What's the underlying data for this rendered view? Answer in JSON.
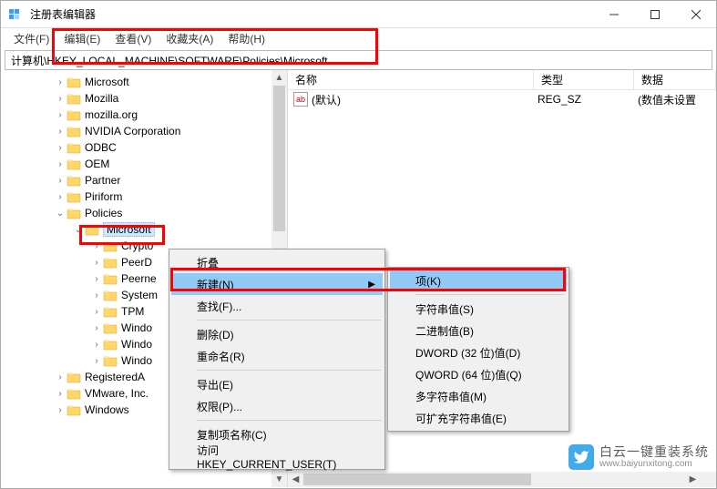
{
  "window": {
    "title": "注册表编辑器"
  },
  "menubar": {
    "file": "文件(F)",
    "edit": "编辑(E)",
    "view": "查看(V)",
    "favorites": "收藏夹(A)",
    "help": "帮助(H)"
  },
  "address": "计算机\\HKEY_LOCAL_MACHINE\\SOFTWARE\\Policies\\Microsoft",
  "tree": [
    {
      "label": "Microsoft",
      "indent": 58
    },
    {
      "label": "Mozilla",
      "indent": 58
    },
    {
      "label": "mozilla.org",
      "indent": 58
    },
    {
      "label": "NVIDIA Corporation",
      "indent": 58
    },
    {
      "label": "ODBC",
      "indent": 58
    },
    {
      "label": "OEM",
      "indent": 58
    },
    {
      "label": "Partner",
      "indent": 58
    },
    {
      "label": "Piriform",
      "indent": 58
    },
    {
      "label": "Policies",
      "indent": 58,
      "expanded": true
    },
    {
      "label": "Microsoft",
      "indent": 78,
      "selected": true,
      "expanded": true
    },
    {
      "label": "Crypto",
      "indent": 98
    },
    {
      "label": "PeerD",
      "indent": 98
    },
    {
      "label": "Peerne",
      "indent": 98
    },
    {
      "label": "System",
      "indent": 98
    },
    {
      "label": "TPM",
      "indent": 98
    },
    {
      "label": "Windo",
      "indent": 98
    },
    {
      "label": "Windo",
      "indent": 98
    },
    {
      "label": "Windo",
      "indent": 98
    },
    {
      "label": "RegisteredA",
      "indent": 58
    },
    {
      "label": "VMware, Inc.",
      "indent": 58
    },
    {
      "label": "Windows",
      "indent": 58
    }
  ],
  "list": {
    "cols": {
      "name": "名称",
      "type": "类型",
      "data": "数据"
    },
    "default_label": "(默认)",
    "default_type": "REG_SZ",
    "default_data": "(数值未设置"
  },
  "context1": {
    "collapse": "折叠",
    "new": "新建(N)",
    "find": "查找(F)...",
    "delete": "删除(D)",
    "rename": "重命名(R)",
    "export": "导出(E)",
    "permissions": "权限(P)...",
    "copykey": "复制项名称(C)",
    "goto": "访问 HKEY_CURRENT_USER(T)"
  },
  "context2": {
    "key": "项(K)",
    "string": "字符串值(S)",
    "binary": "二进制值(B)",
    "dword": "DWORD (32 位)值(D)",
    "qword": "QWORD (64 位)值(Q)",
    "multi": "多字符串值(M)",
    "expand": "可扩充字符串值(E)"
  },
  "watermark": {
    "zh": "白云一键重装系统",
    "url": "www.baiyunxitong.com"
  }
}
